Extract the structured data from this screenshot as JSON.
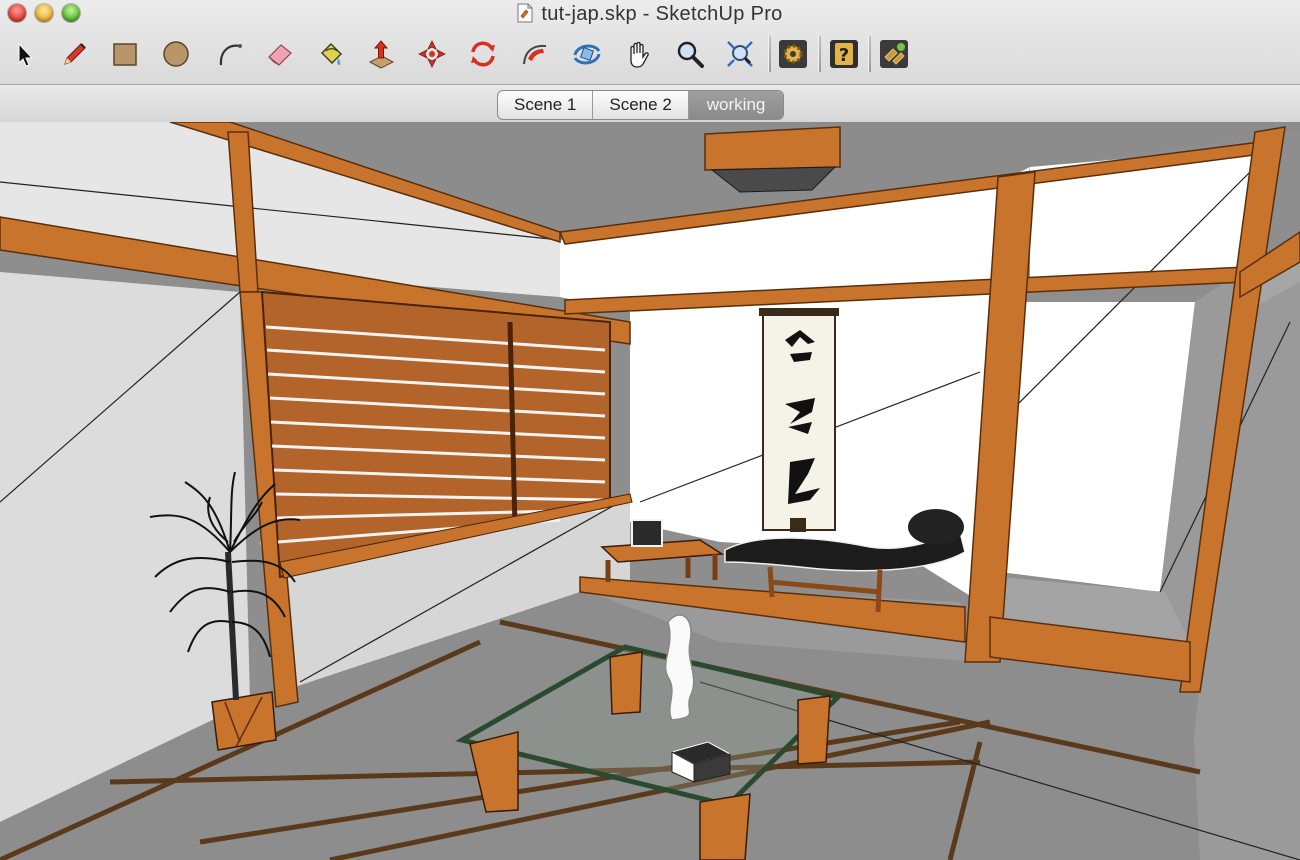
{
  "window": {
    "title": "tut-jap.skp - SketchUp Pro"
  },
  "toolbar": {
    "tools": [
      {
        "name": "select-tool-icon",
        "label": "Select"
      },
      {
        "name": "pencil-tool-icon",
        "label": "Line"
      },
      {
        "name": "rectangle-tool-icon",
        "label": "Rectangle"
      },
      {
        "name": "circle-tool-icon",
        "label": "Circle"
      },
      {
        "name": "arc-tool-icon",
        "label": "Arc"
      },
      {
        "name": "eraser-tool-icon",
        "label": "Eraser"
      },
      {
        "name": "paint-bucket-tool-icon",
        "label": "Paint Bucket"
      },
      {
        "name": "push-pull-tool-icon",
        "label": "Push/Pull"
      },
      {
        "name": "move-tool-icon",
        "label": "Move"
      },
      {
        "name": "rotate-tool-icon",
        "label": "Rotate"
      },
      {
        "name": "follow-me-tool-icon",
        "label": "Follow Me"
      },
      {
        "name": "orbit-tool-icon",
        "label": "Orbit"
      },
      {
        "name": "pan-tool-icon",
        "label": "Pan"
      },
      {
        "name": "zoom-tool-icon",
        "label": "Zoom"
      },
      {
        "name": "zoom-extents-tool-icon",
        "label": "Zoom Extents"
      },
      {
        "name": "settings-gear-icon",
        "label": "Settings"
      },
      {
        "name": "help-icon",
        "label": "Instructor"
      },
      {
        "name": "extension-warehouse-icon",
        "label": "Extensions"
      }
    ]
  },
  "scenes": {
    "tabs": [
      {
        "label": "Scene 1",
        "active": false
      },
      {
        "label": "Scene 2",
        "active": false
      },
      {
        "label": "working",
        "active": true
      }
    ]
  },
  "colors": {
    "wood": "#c8742c",
    "wood_dark": "#8a4a18",
    "floor": "#8d8d8d",
    "wall_white": "#ffffff",
    "wall_gray": "#e4e4e4"
  }
}
